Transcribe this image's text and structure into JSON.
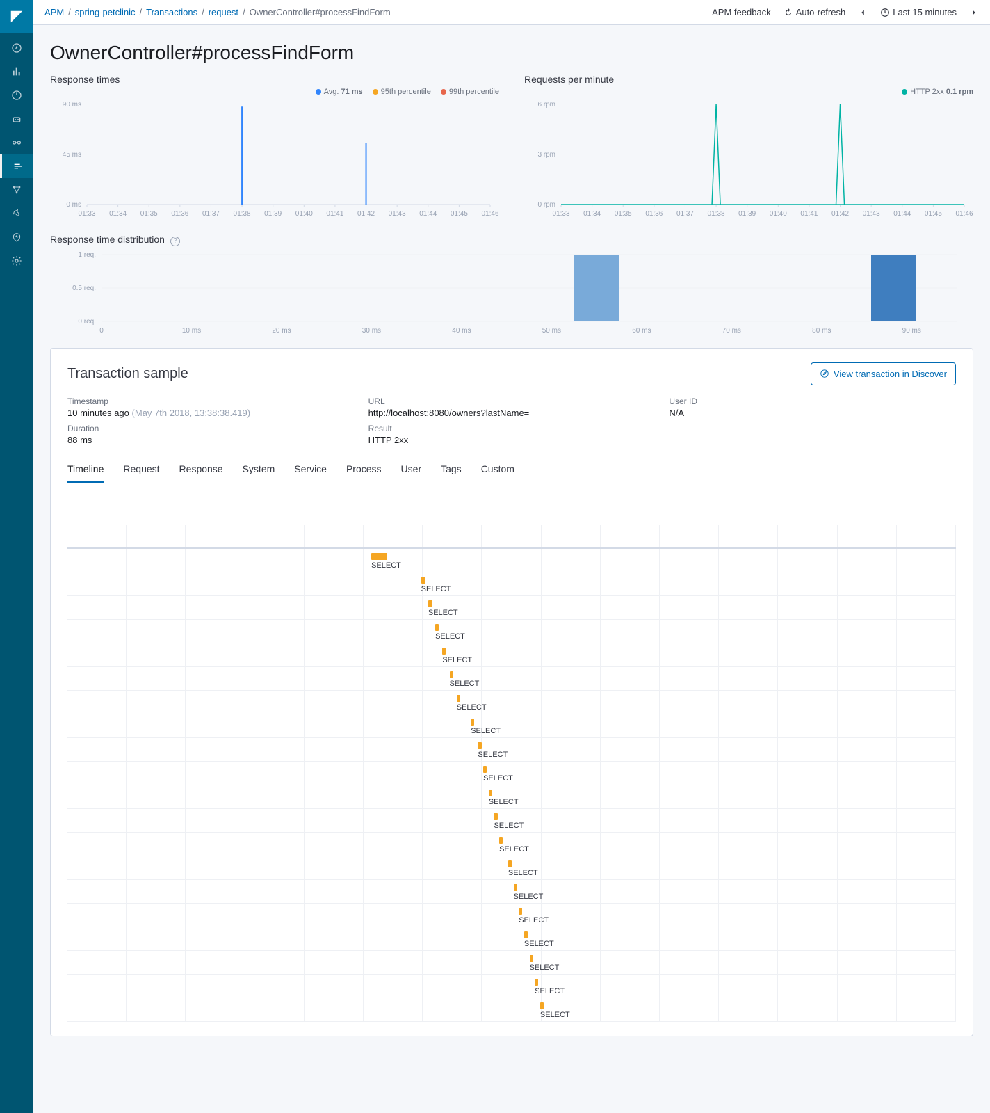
{
  "breadcrumbs": [
    "APM",
    "spring-petclinic",
    "Transactions",
    "request",
    "OwnerController#processFindForm"
  ],
  "top_actions": {
    "feedback": "APM feedback",
    "auto_refresh": "Auto-refresh",
    "time_range": "Last 15 minutes"
  },
  "page_title": "OwnerController#processFindForm",
  "response_times": {
    "title": "Response times",
    "legend_avg_label": "Avg.",
    "legend_avg_value": "71 ms",
    "legend_p95": "95th percentile",
    "legend_p99": "99th percentile"
  },
  "requests_per_minute": {
    "title": "Requests per minute",
    "legend_series": "HTTP 2xx",
    "legend_value": "0.1 rpm"
  },
  "distribution": {
    "title": "Response time distribution"
  },
  "transaction_sample": {
    "title": "Transaction sample",
    "discover_btn": "View transaction in Discover",
    "timestamp_label": "Timestamp",
    "timestamp_value": "10 minutes ago",
    "timestamp_sub": "(May 7th 2018, 13:38:38.419)",
    "url_label": "URL",
    "url_value": "http://localhost:8080/owners?lastName=",
    "duration_label": "Duration",
    "duration_value": "88 ms",
    "result_label": "Result",
    "result_value": "HTTP 2xx",
    "user_label": "User ID",
    "user_value": "N/A"
  },
  "tabs": [
    "Timeline",
    "Request",
    "Response",
    "System",
    "Service",
    "Process",
    "User",
    "Tags",
    "Custom"
  ],
  "chart_data": [
    {
      "type": "line",
      "title": "Response times",
      "x_ticks": [
        "01:33",
        "01:34",
        "01:35",
        "01:36",
        "01:37",
        "01:38",
        "01:39",
        "01:40",
        "01:41",
        "01:42",
        "01:43",
        "01:44",
        "01:45",
        "01:46"
      ],
      "y_ticks": [
        "0 ms",
        "45 ms",
        "90 ms"
      ],
      "ylim": [
        0,
        90
      ],
      "series": [
        {
          "name": "Avg.",
          "color": "#3185fc",
          "points": [
            {
              "x": "01:38",
              "y": 88
            },
            {
              "x": "01:42",
              "y": 55
            }
          ]
        },
        {
          "name": "95th percentile",
          "color": "#f5a623",
          "points": []
        },
        {
          "name": "99th percentile",
          "color": "#e7664c",
          "points": []
        }
      ]
    },
    {
      "type": "line",
      "title": "Requests per minute",
      "x_ticks": [
        "01:33",
        "01:34",
        "01:35",
        "01:36",
        "01:37",
        "01:38",
        "01:39",
        "01:40",
        "01:41",
        "01:42",
        "01:43",
        "01:44",
        "01:45",
        "01:46"
      ],
      "y_ticks": [
        "0 rpm",
        "3 rpm",
        "6 rpm"
      ],
      "ylim": [
        0,
        6
      ],
      "series": [
        {
          "name": "HTTP 2xx",
          "color": "#00b3a4",
          "points": [
            {
              "x": "01:38",
              "y": 6
            },
            {
              "x": "01:42",
              "y": 6
            }
          ]
        }
      ]
    },
    {
      "type": "bar",
      "title": "Response time distribution",
      "x_ticks": [
        "0",
        "10 ms",
        "20 ms",
        "30 ms",
        "40 ms",
        "50 ms",
        "60 ms",
        "70 ms",
        "80 ms",
        "90 ms"
      ],
      "y_ticks": [
        "0 req.",
        "0.5 req.",
        "1 req."
      ],
      "xlim": [
        0,
        95
      ],
      "ylim": [
        0,
        1
      ],
      "bars": [
        {
          "x": 55,
          "value": 1,
          "selected": false,
          "color": "#79aad9"
        },
        {
          "x": 88,
          "value": 1,
          "selected": true,
          "color": "#3f7ebf"
        }
      ]
    }
  ],
  "waterfall": {
    "columns": 15,
    "spans": [
      {
        "left_pct": 34.2,
        "width_pct": 1.8,
        "label": "SELECT"
      },
      {
        "left_pct": 39.8,
        "width_pct": 0.5,
        "label": "SELECT"
      },
      {
        "left_pct": 40.6,
        "width_pct": 0.5,
        "label": "SELECT"
      },
      {
        "left_pct": 41.4,
        "width_pct": 0.4,
        "label": "SELECT"
      },
      {
        "left_pct": 42.2,
        "width_pct": 0.4,
        "label": "SELECT"
      },
      {
        "left_pct": 43.0,
        "width_pct": 0.4,
        "label": "SELECT"
      },
      {
        "left_pct": 43.8,
        "width_pct": 0.4,
        "label": "SELECT"
      },
      {
        "left_pct": 45.4,
        "width_pct": 0.4,
        "label": "SELECT"
      },
      {
        "left_pct": 46.2,
        "width_pct": 0.4,
        "label": "SELECT"
      },
      {
        "left_pct": 46.8,
        "width_pct": 0.4,
        "label": "SELECT"
      },
      {
        "left_pct": 47.4,
        "width_pct": 0.4,
        "label": "SELECT"
      },
      {
        "left_pct": 48.0,
        "width_pct": 0.4,
        "label": "SELECT"
      },
      {
        "left_pct": 48.6,
        "width_pct": 0.4,
        "label": "SELECT"
      },
      {
        "left_pct": 49.6,
        "width_pct": 0.4,
        "label": "SELECT"
      },
      {
        "left_pct": 50.2,
        "width_pct": 0.4,
        "label": "SELECT"
      },
      {
        "left_pct": 50.8,
        "width_pct": 0.4,
        "label": "SELECT"
      },
      {
        "left_pct": 51.4,
        "width_pct": 0.4,
        "label": "SELECT"
      },
      {
        "left_pct": 52.0,
        "width_pct": 0.4,
        "label": "SELECT"
      },
      {
        "left_pct": 52.6,
        "width_pct": 0.4,
        "label": "SELECT"
      },
      {
        "left_pct": 53.2,
        "width_pct": 0.4,
        "label": "SELECT"
      }
    ]
  }
}
